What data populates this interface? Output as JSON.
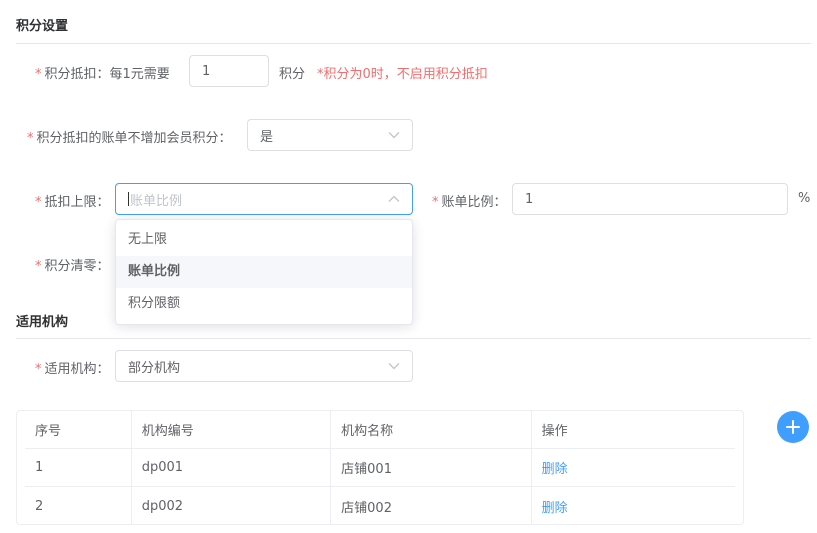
{
  "sections": {
    "points_settings": "积分设置",
    "applicable_org": "适用机构"
  },
  "points_deduct": {
    "label": "积分抵扣：",
    "prefix": "每1元需要",
    "value": "1",
    "unit": "积分",
    "hint": "*积分为0时，不启用积分抵扣"
  },
  "no_member_points": {
    "label": "积分抵扣的账单不增加会员积分：",
    "value": "是"
  },
  "deduct_limit": {
    "label": "抵扣上限：",
    "placeholder": "账单比例",
    "options": [
      "无上限",
      "账单比例",
      "积分限额"
    ],
    "selected_index": 1
  },
  "bill_ratio": {
    "label": "账单比例：",
    "value": "1",
    "suffix": "%"
  },
  "points_clear": {
    "label": "积分清零："
  },
  "org": {
    "label": "适用机构：",
    "value": "部分机构"
  },
  "table": {
    "headers": [
      "序号",
      "机构编号",
      "机构名称",
      "操作"
    ],
    "rows": [
      {
        "index": "1",
        "code": "dp001",
        "name": "店铺001",
        "action": "删除"
      },
      {
        "index": "2",
        "code": "dp002",
        "name": "店铺002",
        "action": "删除"
      }
    ]
  },
  "colors": {
    "primary": "#409eff",
    "required": "#f56c6c",
    "border": "#dcdfe6"
  },
  "icons": {
    "select_arrow": "chevron-down-icon",
    "add": "plus-icon"
  }
}
